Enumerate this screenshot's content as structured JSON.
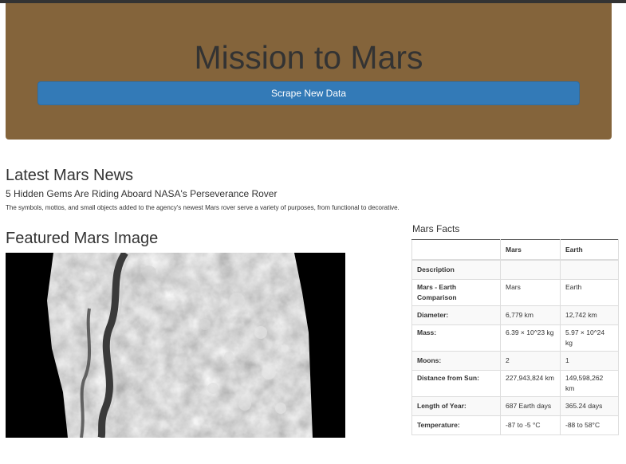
{
  "header": {
    "title": "Mission to Mars",
    "scrape_label": "Scrape New Data"
  },
  "news": {
    "heading": "Latest Mars News",
    "title": "5 Hidden Gems Are Riding Aboard NASA's Perseverance Rover",
    "paragraph": "The symbols, mottos, and small objects added to the agency's newest Mars rover serve a variety of purposes, from functional to decorative."
  },
  "featured": {
    "heading": "Featured Mars Image"
  },
  "facts": {
    "heading": "Mars Facts",
    "columns": [
      "Mars",
      "Earth"
    ],
    "rows": [
      {
        "label": "Description",
        "mars": "",
        "earth": ""
      },
      {
        "label": "Mars - Earth Comparison",
        "mars": "Mars",
        "earth": "Earth"
      },
      {
        "label": "Diameter:",
        "mars": "6,779 km",
        "earth": "12,742 km"
      },
      {
        "label": "Mass:",
        "mars": "6.39 × 10^23 kg",
        "earth": "5.97 × 10^24 kg"
      },
      {
        "label": "Moons:",
        "mars": "2",
        "earth": "1"
      },
      {
        "label": "Distance from Sun:",
        "mars": "227,943,824 km",
        "earth": "149,598,262 km"
      },
      {
        "label": "Length of Year:",
        "mars": "687 Earth days",
        "earth": "365.24 days"
      },
      {
        "label": "Temperature:",
        "mars": "-87 to -5 °C",
        "earth": "-88 to 58°C"
      }
    ]
  },
  "colors": {
    "jumbotron": "#84643b",
    "button": "#337ab7"
  }
}
